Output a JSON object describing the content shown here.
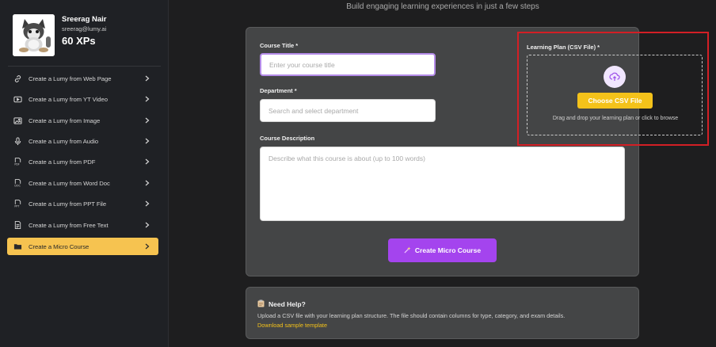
{
  "profile": {
    "name": "Sreerag Nair",
    "email": "sreerag@lumy.ai",
    "xp": "60 XPs"
  },
  "sidebar": {
    "items": [
      {
        "label": "Create a Lumy from Web Page",
        "icon": "link-icon"
      },
      {
        "label": "Create a Lumy from YT Video",
        "icon": "video-icon"
      },
      {
        "label": "Create a Lumy from Image",
        "icon": "image-icon"
      },
      {
        "label": "Create a Lumy from Audio",
        "icon": "microphone-icon"
      },
      {
        "label": "Create a Lumy from PDF",
        "icon": "pdf-file-icon"
      },
      {
        "label": "Create a Lumy from Word Doc",
        "icon": "doc-file-icon"
      },
      {
        "label": "Create a Lumy from PPT File",
        "icon": "ppt-file-icon"
      },
      {
        "label": "Create a Lumy from Free Text",
        "icon": "text-file-icon"
      },
      {
        "label": "Create a Micro Course",
        "icon": "folder-icon",
        "active": true
      }
    ]
  },
  "main": {
    "subtitle": "Build engaging learning experiences in just a few steps",
    "form": {
      "course_title_label": "Course Title *",
      "course_title_placeholder": "Enter your course title",
      "department_label": "Department *",
      "department_placeholder": "Search and select department",
      "description_label": "Course Description",
      "description_placeholder": "Describe what this course is about (up to 100 words)",
      "csv_label": "Learning Plan (CSV File) *",
      "choose_csv": "Choose CSV File",
      "drop_text": "Drag and drop your learning plan or click to browse",
      "create_button": "Create Micro Course"
    },
    "help": {
      "title": "Need Help?",
      "text": "Upload a CSV file with your learning plan structure. The file should contain columns for type, category, and exam details.",
      "link": "Download sample template"
    }
  },
  "colors": {
    "accent_purple": "#a444ee",
    "accent_yellow": "#f4c21a",
    "active_nav": "#f6c350",
    "highlight_red": "#d31f25"
  }
}
